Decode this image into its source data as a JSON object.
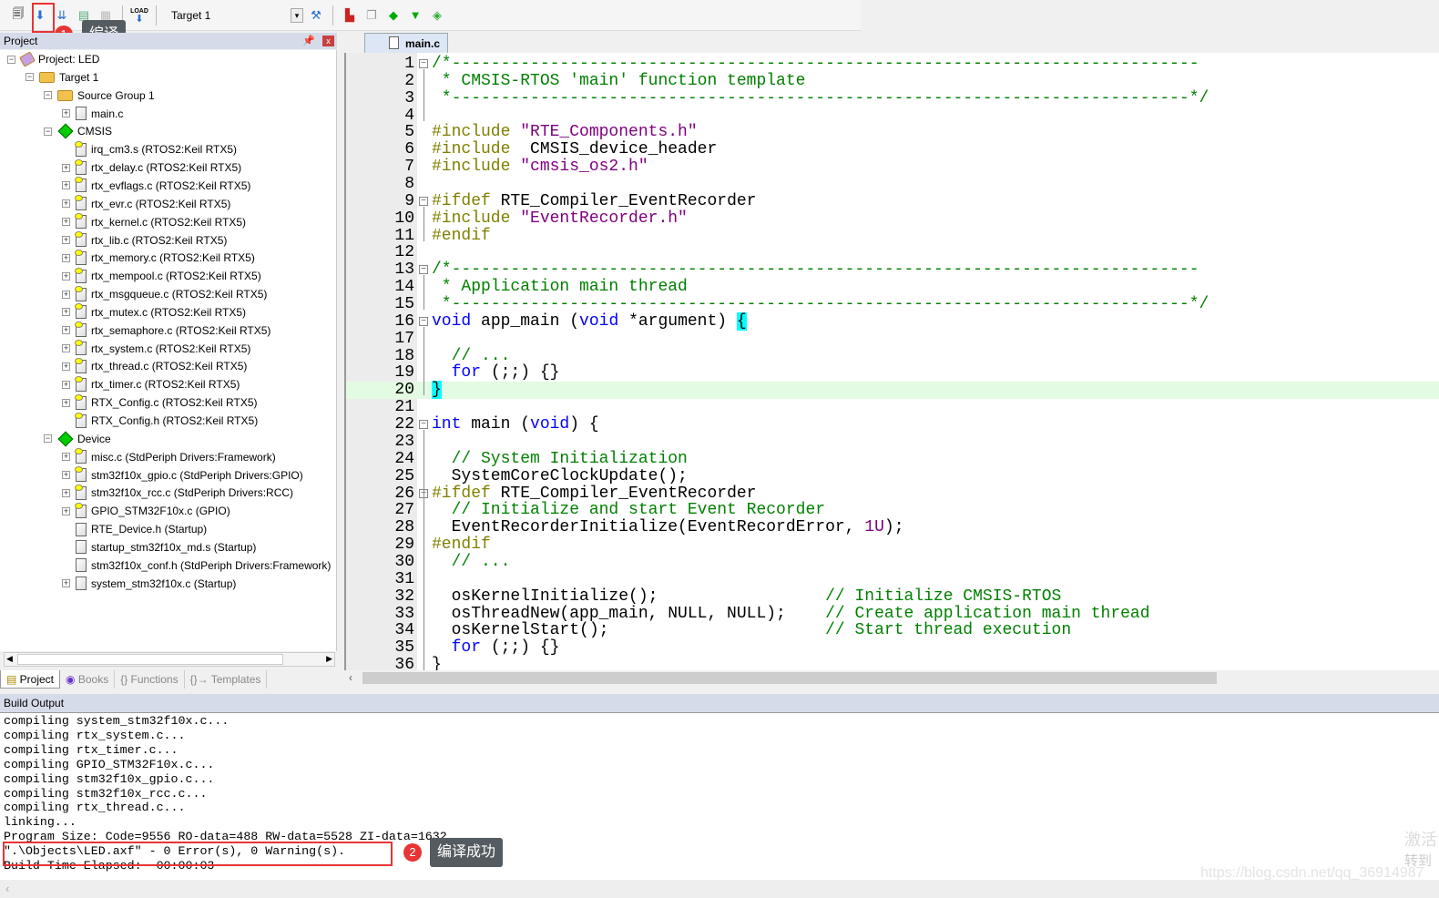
{
  "toolbar": {
    "target": "Target 1",
    "load_label": "LOAD",
    "icons": [
      "translate-icon",
      "build-icon",
      "rebuild-icon",
      "batch-build-icon",
      "stop-build-icon",
      "download-icon",
      "target-options-icon",
      "manage-components-icon",
      "file-extensions-icon",
      "run-time-env-icon",
      "pack-installer-icon",
      "select-packs-icon"
    ]
  },
  "annotations": {
    "a1": {
      "badge": "1",
      "tip": "编译"
    },
    "a2": {
      "badge": "2",
      "tip": "编译成功"
    }
  },
  "project_panel": {
    "title": "Project",
    "tree": [
      {
        "label": "Project: LED",
        "depth": 0,
        "exp": "-",
        "icon": "project"
      },
      {
        "label": "Target 1",
        "depth": 1,
        "exp": "-",
        "icon": "folder"
      },
      {
        "label": "Source Group 1",
        "depth": 2,
        "exp": "-",
        "icon": "folder"
      },
      {
        "label": "main.c",
        "depth": 3,
        "exp": "+",
        "icon": "file"
      },
      {
        "label": "CMSIS",
        "depth": 2,
        "exp": "-",
        "icon": "diamond"
      },
      {
        "label": "irq_cm3.s (RTOS2:Keil RTX5)",
        "depth": 3,
        "exp": "",
        "icon": "key"
      },
      {
        "label": "rtx_delay.c (RTOS2:Keil RTX5)",
        "depth": 3,
        "exp": "+",
        "icon": "key"
      },
      {
        "label": "rtx_evflags.c (RTOS2:Keil RTX5)",
        "depth": 3,
        "exp": "+",
        "icon": "key"
      },
      {
        "label": "rtx_evr.c (RTOS2:Keil RTX5)",
        "depth": 3,
        "exp": "+",
        "icon": "key"
      },
      {
        "label": "rtx_kernel.c (RTOS2:Keil RTX5)",
        "depth": 3,
        "exp": "+",
        "icon": "key"
      },
      {
        "label": "rtx_lib.c (RTOS2:Keil RTX5)",
        "depth": 3,
        "exp": "+",
        "icon": "key"
      },
      {
        "label": "rtx_memory.c (RTOS2:Keil RTX5)",
        "depth": 3,
        "exp": "+",
        "icon": "key"
      },
      {
        "label": "rtx_mempool.c (RTOS2:Keil RTX5)",
        "depth": 3,
        "exp": "+",
        "icon": "key"
      },
      {
        "label": "rtx_msgqueue.c (RTOS2:Keil RTX5)",
        "depth": 3,
        "exp": "+",
        "icon": "key"
      },
      {
        "label": "rtx_mutex.c (RTOS2:Keil RTX5)",
        "depth": 3,
        "exp": "+",
        "icon": "key"
      },
      {
        "label": "rtx_semaphore.c (RTOS2:Keil RTX5)",
        "depth": 3,
        "exp": "+",
        "icon": "key"
      },
      {
        "label": "rtx_system.c (RTOS2:Keil RTX5)",
        "depth": 3,
        "exp": "+",
        "icon": "key"
      },
      {
        "label": "rtx_thread.c (RTOS2:Keil RTX5)",
        "depth": 3,
        "exp": "+",
        "icon": "key"
      },
      {
        "label": "rtx_timer.c (RTOS2:Keil RTX5)",
        "depth": 3,
        "exp": "+",
        "icon": "key"
      },
      {
        "label": "RTX_Config.c (RTOS2:Keil RTX5)",
        "depth": 3,
        "exp": "+",
        "icon": "key"
      },
      {
        "label": "RTX_Config.h (RTOS2:Keil RTX5)",
        "depth": 3,
        "exp": "",
        "icon": "key"
      },
      {
        "label": "Device",
        "depth": 2,
        "exp": "-",
        "icon": "diamond"
      },
      {
        "label": "misc.c (StdPeriph Drivers:Framework)",
        "depth": 3,
        "exp": "+",
        "icon": "key"
      },
      {
        "label": "stm32f10x_gpio.c (StdPeriph Drivers:GPIO)",
        "depth": 3,
        "exp": "+",
        "icon": "key"
      },
      {
        "label": "stm32f10x_rcc.c (StdPeriph Drivers:RCC)",
        "depth": 3,
        "exp": "+",
        "icon": "key"
      },
      {
        "label": "GPIO_STM32F10x.c (GPIO)",
        "depth": 3,
        "exp": "+",
        "icon": "key"
      },
      {
        "label": "RTE_Device.h (Startup)",
        "depth": 3,
        "exp": "",
        "icon": "file"
      },
      {
        "label": "startup_stm32f10x_md.s (Startup)",
        "depth": 3,
        "exp": "",
        "icon": "file"
      },
      {
        "label": "stm32f10x_conf.h (StdPeriph Drivers:Framework)",
        "depth": 3,
        "exp": "",
        "icon": "file"
      },
      {
        "label": "system_stm32f10x.c (Startup)",
        "depth": 3,
        "exp": "+",
        "icon": "file"
      }
    ],
    "tabs": [
      "Project",
      "Books",
      "{} Functions",
      "{}→ Templates"
    ]
  },
  "editor": {
    "tab": "main.c",
    "current_line": 20,
    "lines": [
      [
        [
          "c",
          "/*----------------------------------------------------------------------------"
        ]
      ],
      [
        [
          "c",
          " * CMSIS-RTOS 'main' function template"
        ]
      ],
      [
        [
          "c",
          " *---------------------------------------------------------------------------*/"
        ]
      ],
      [],
      [
        [
          "p",
          "#include "
        ],
        [
          "s",
          "\"RTE_Components.h\""
        ]
      ],
      [
        [
          "p",
          "#include "
        ],
        [
          "n",
          " CMSIS_device_header"
        ]
      ],
      [
        [
          "p",
          "#include "
        ],
        [
          "s",
          "\"cmsis_os2.h\""
        ]
      ],
      [],
      [
        [
          "p",
          "#ifdef "
        ],
        [
          "n",
          "RTE_Compiler_EventRecorder"
        ]
      ],
      [
        [
          "p",
          "#include "
        ],
        [
          "s",
          "\"EventRecorder.h\""
        ]
      ],
      [
        [
          "p",
          "#endif"
        ]
      ],
      [],
      [
        [
          "c",
          "/*----------------------------------------------------------------------------"
        ]
      ],
      [
        [
          "c",
          " * Application main thread"
        ]
      ],
      [
        [
          "c",
          " *---------------------------------------------------------------------------*/"
        ]
      ],
      [
        [
          "k",
          "void"
        ],
        [
          "n",
          " app_main ("
        ],
        [
          "k",
          "void"
        ],
        [
          "n",
          " *argument) "
        ],
        [
          "h",
          "{"
        ]
      ],
      [],
      [
        [
          "c",
          "  // ..."
        ]
      ],
      [
        [
          "n",
          "  "
        ],
        [
          "k",
          "for"
        ],
        [
          "n",
          " (;;) {}"
        ]
      ],
      [
        [
          "h",
          "}"
        ]
      ],
      [],
      [
        [
          "k",
          "int"
        ],
        [
          "n",
          " main ("
        ],
        [
          "k",
          "void"
        ],
        [
          "n",
          ") {"
        ]
      ],
      [],
      [
        [
          "c",
          "  // System Initialization"
        ]
      ],
      [
        [
          "n",
          "  SystemCoreClockUpdate();"
        ]
      ],
      [
        [
          "p",
          "#ifdef "
        ],
        [
          "n",
          "RTE_Compiler_EventRecorder"
        ]
      ],
      [
        [
          "c",
          "  // Initialize and start Event Recorder"
        ]
      ],
      [
        [
          "n",
          "  EventRecorderInitialize(EventRecordError, "
        ],
        [
          "s",
          "1U"
        ],
        [
          "n",
          ");"
        ]
      ],
      [
        [
          "p",
          "#endif"
        ]
      ],
      [
        [
          "c",
          "  // ..."
        ]
      ],
      [],
      [
        [
          "n",
          "  osKernelInitialize();                 "
        ],
        [
          "c",
          "// Initialize CMSIS-RTOS"
        ]
      ],
      [
        [
          "n",
          "  osThreadNew(app_main, NULL, NULL);    "
        ],
        [
          "c",
          "// Create application main thread"
        ]
      ],
      [
        [
          "n",
          "  osKernelStart();                      "
        ],
        [
          "c",
          "// Start thread execution"
        ]
      ],
      [
        [
          "n",
          "  "
        ],
        [
          "k",
          "for"
        ],
        [
          "n",
          " (;;) {}"
        ]
      ],
      [
        [
          "n",
          "}"
        ]
      ]
    ],
    "folds": [
      1,
      9,
      13,
      16,
      22,
      26
    ]
  },
  "build_output": {
    "title": "Build Output",
    "lines": [
      "compiling system_stm32f10x.c...",
      "compiling rtx_system.c...",
      "compiling rtx_timer.c...",
      "compiling GPIO_STM32F10x.c...",
      "compiling stm32f10x_gpio.c...",
      "compiling stm32f10x_rcc.c...",
      "compiling rtx_thread.c...",
      "linking...",
      "Program Size: Code=9556 RO-data=488 RW-data=5528 ZI-data=1632",
      "\".\\Objects\\LED.axf\" - 0 Error(s), 0 Warning(s).",
      "Build Time Elapsed:  00:00:03"
    ]
  },
  "watermark": {
    "url": "https://blog.csdn.net/qq_36914987",
    "line1": "激活",
    "line2": "转到"
  },
  "colors": {
    "keyword": "#0000ff",
    "comment": "#008000",
    "preprocessor": "#808000",
    "string": "#800080",
    "annotation": "#e83434"
  }
}
